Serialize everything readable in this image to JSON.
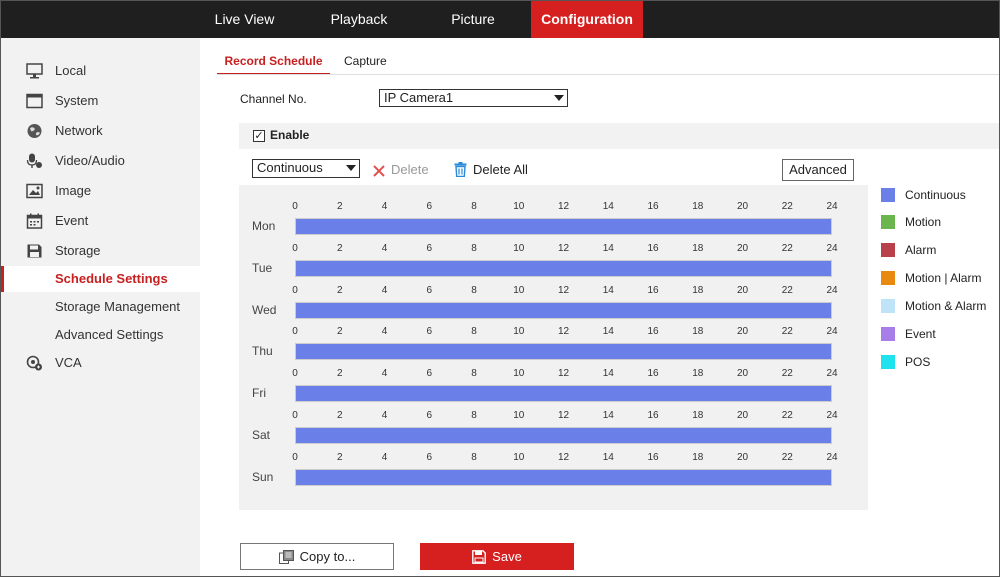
{
  "nav": {
    "tabs": [
      {
        "label": "Live View"
      },
      {
        "label": "Playback"
      },
      {
        "label": "Picture"
      },
      {
        "label": "Configuration"
      }
    ],
    "active_tab": "Configuration"
  },
  "sidebar": {
    "items": [
      {
        "label": "Local",
        "icon": "monitor-icon"
      },
      {
        "label": "System",
        "icon": "window-icon"
      },
      {
        "label": "Network",
        "icon": "globe-icon"
      },
      {
        "label": "Video/Audio",
        "icon": "mic-icon"
      },
      {
        "label": "Image",
        "icon": "image-icon"
      },
      {
        "label": "Event",
        "icon": "calendar-icon"
      },
      {
        "label": "Storage",
        "icon": "floppy-icon"
      }
    ],
    "storage_sub": [
      {
        "label": "Schedule Settings"
      },
      {
        "label": "Storage Management"
      },
      {
        "label": "Advanced Settings"
      }
    ],
    "vca": {
      "label": "VCA",
      "icon": "vca-icon"
    },
    "active_item": "Schedule Settings"
  },
  "subtabs": [
    {
      "label": "Record Schedule"
    },
    {
      "label": "Capture"
    }
  ],
  "active_subtab": "Record Schedule",
  "channel": {
    "label": "Channel No.",
    "value": "IP Camera1"
  },
  "enable": {
    "label": "Enable",
    "checked": true
  },
  "toolbar": {
    "type_value": "Continuous",
    "delete_label": "Delete",
    "delete_all_label": "Delete All",
    "advanced_label": "Advanced"
  },
  "schedule": {
    "hour_ticks": [
      "0",
      "2",
      "4",
      "6",
      "8",
      "10",
      "12",
      "14",
      "16",
      "18",
      "20",
      "22",
      "24"
    ],
    "days": [
      {
        "label": "Mon",
        "start": 0,
        "end": 24,
        "type": "Continuous"
      },
      {
        "label": "Tue",
        "start": 0,
        "end": 24,
        "type": "Continuous"
      },
      {
        "label": "Wed",
        "start": 0,
        "end": 24,
        "type": "Continuous"
      },
      {
        "label": "Thu",
        "start": 0,
        "end": 24,
        "type": "Continuous"
      },
      {
        "label": "Fri",
        "start": 0,
        "end": 24,
        "type": "Continuous"
      },
      {
        "label": "Sat",
        "start": 0,
        "end": 24,
        "type": "Continuous"
      },
      {
        "label": "Sun",
        "start": 0,
        "end": 24,
        "type": "Continuous"
      }
    ]
  },
  "legend": [
    {
      "label": "Continuous",
      "color": "#6a80e8"
    },
    {
      "label": "Motion",
      "color": "#6ab54e"
    },
    {
      "label": "Alarm",
      "color": "#b8404a"
    },
    {
      "label": "Motion | Alarm",
      "color": "#e88a10"
    },
    {
      "label": "Motion & Alarm",
      "color": "#bfe3f7"
    },
    {
      "label": "Event",
      "color": "#a77ee8"
    },
    {
      "label": "POS",
      "color": "#1ee3ef"
    }
  ],
  "buttons": {
    "copy_label": "Copy to...",
    "save_label": "Save"
  },
  "colors": {
    "accent": "#d61f1f",
    "nav_bg": "#1f1f1f",
    "sidebar_bg": "#f2f2f2",
    "continuous_bar": "#6a80e8"
  }
}
